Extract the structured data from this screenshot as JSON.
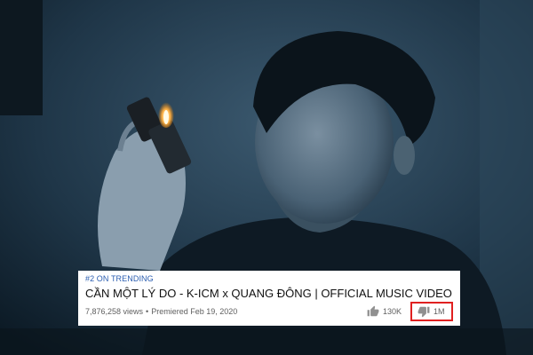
{
  "video": {
    "trending_badge": "#2 ON TRENDING",
    "title": "CẦN MỘT LÝ DO - K-ICM x QUANG ĐÔNG | OFFICIAL MUSIC VIDEO",
    "views": "7,876,258 views",
    "separator": "•",
    "premiered": "Premiered Feb 19, 2020",
    "likes": "130K",
    "dislikes": "1M"
  },
  "icons": {
    "like": "thumbs-up-icon",
    "dislike": "thumbs-down-icon"
  },
  "colors": {
    "trending": "#2a5db0",
    "highlight_border": "#e02020",
    "background_tone": "#0f2230"
  }
}
